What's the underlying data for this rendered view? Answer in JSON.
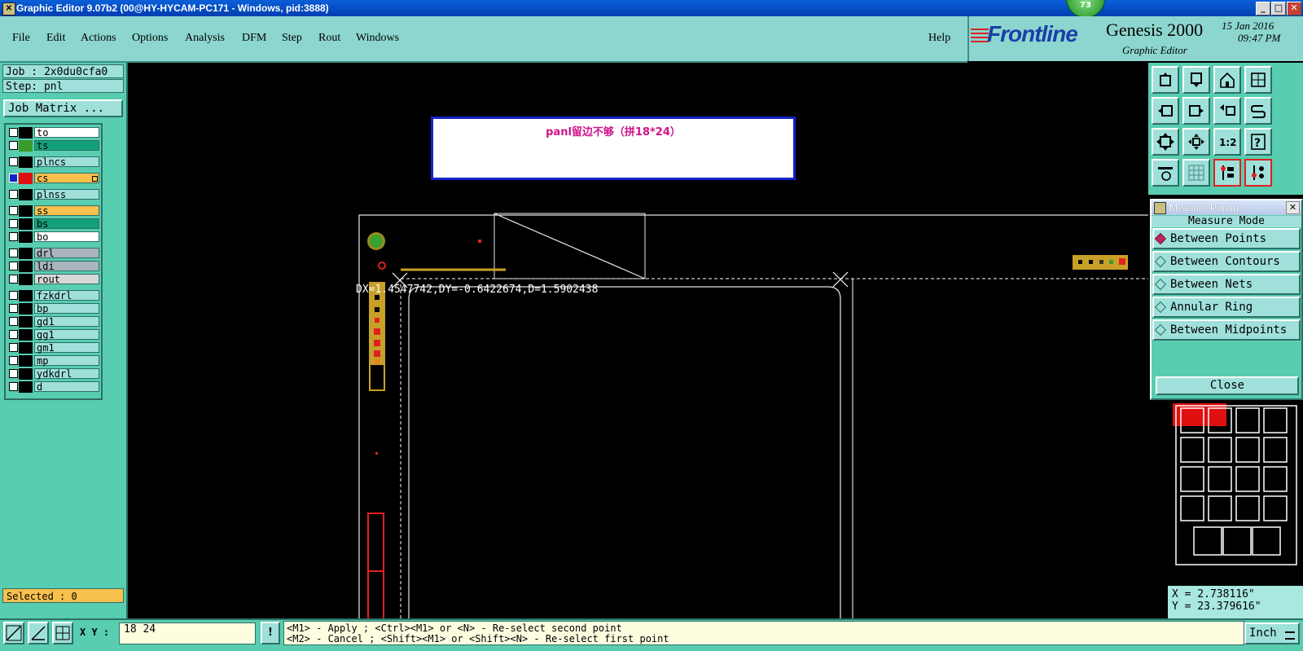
{
  "window": {
    "title": "Graphic Editor 9.07b2 (00@HY-HYCAM-PC171 - Windows, pid:3888)",
    "badge": "73",
    "controls": [
      "_",
      "□",
      "✕"
    ]
  },
  "menu": {
    "items": [
      "File",
      "Edit",
      "Actions",
      "Options",
      "Analysis",
      "DFM",
      "Step",
      "Rout",
      "Windows"
    ],
    "help": "Help"
  },
  "branding": {
    "logo": "Frontline",
    "product": "Genesis 2000",
    "module": "Graphic Editor",
    "date": "15 Jan 2016",
    "time": "09:47 PM"
  },
  "left_panel": {
    "job": "Job : 2x0du0cfa0",
    "step": "Step: pnl",
    "job_matrix": "Job Matrix ...",
    "layers": [
      {
        "name": "to",
        "color": "#ffffff",
        "swatch": "#000000",
        "active": false
      },
      {
        "name": "ts",
        "color": "#13a077",
        "swatch": "#3a9a2a",
        "active": false
      },
      {
        "name": "plncs",
        "color": "#9fe1da",
        "swatch": "#000000",
        "active": false
      },
      {
        "name": "cs",
        "color": "#f8c04c",
        "swatch": "#e01010",
        "active": true
      },
      {
        "name": "plnss",
        "color": "#9fe1da",
        "swatch": "#000000",
        "active": false
      },
      {
        "name": "ss",
        "color": "#f8c04c",
        "swatch": "#000000",
        "active": false
      },
      {
        "name": "bs",
        "color": "#13a077",
        "swatch": "#000000",
        "active": false
      },
      {
        "name": "bo",
        "color": "#ffffff",
        "swatch": "#000000",
        "active": false
      },
      {
        "name": "drl",
        "color": "#a9b4bc",
        "swatch": "#000000",
        "active": false
      },
      {
        "name": "ldi",
        "color": "#a9b4bc",
        "swatch": "#000000",
        "active": false
      },
      {
        "name": "rout",
        "color": "#d8d8d8",
        "swatch": "#000000",
        "active": false
      },
      {
        "name": "fzkdrl",
        "color": "#9fe1da",
        "swatch": "#000000",
        "active": false
      },
      {
        "name": "bp",
        "color": "#9fe1da",
        "swatch": "#000000",
        "active": false
      },
      {
        "name": "gd1",
        "color": "#9fe1da",
        "swatch": "#000000",
        "active": false
      },
      {
        "name": "gg1",
        "color": "#9fe1da",
        "swatch": "#000000",
        "active": false
      },
      {
        "name": "gm1",
        "color": "#9fe1da",
        "swatch": "#000000",
        "active": false
      },
      {
        "name": "mp",
        "color": "#9fe1da",
        "swatch": "#000000",
        "active": false
      },
      {
        "name": "ydkdrl",
        "color": "#9fe1da",
        "swatch": "#000000",
        "active": false
      },
      {
        "name": "d",
        "color": "#9fe1da",
        "swatch": "#000000",
        "active": false
      }
    ],
    "selected": "Selected : 0"
  },
  "canvas": {
    "note": "panl留边不够（拼18*24）",
    "measure_readout": "DX=1.4547742,DY=-0.6422674,D=1.5902438"
  },
  "toolbar_icons": [
    "zoom-in-icon",
    "zoom-out-icon",
    "home-icon",
    "fit-screen-icon",
    "pan-left-icon",
    "pan-right-icon",
    "undo-view-icon",
    "redraw-icon",
    "zoom-fit-icon",
    "zoom-center-icon",
    "one-to-two-icon",
    "question-icon",
    "tools-icon",
    "grid-icon",
    "netlist-icon",
    "netlist-alt-icon"
  ],
  "toolbar_label_12": "1:2",
  "measure_popup": {
    "title": "Measure Popup",
    "close_x": "✕",
    "mode_label": "Measure Mode",
    "options": [
      "Between Points",
      "Between Contours",
      "Between Nets",
      "Annular Ring",
      "Between Midpoints"
    ],
    "selected_option": "Between Points",
    "close": "Close"
  },
  "coordinates": {
    "x": "X = 2.738116\"",
    "y": "Y = 23.379616\""
  },
  "status_bar": {
    "xy_label": "X Y :",
    "xy_value": "18 24",
    "bang": "!",
    "prompt_line1": "<M1> - Apply  ; <Ctrl><M1> or <N> - Re-select second point",
    "prompt_line2": "<M2> - Cancel ; <Shift><M1> or <Shift><N> - Re-select first point",
    "unit": "Inch"
  }
}
